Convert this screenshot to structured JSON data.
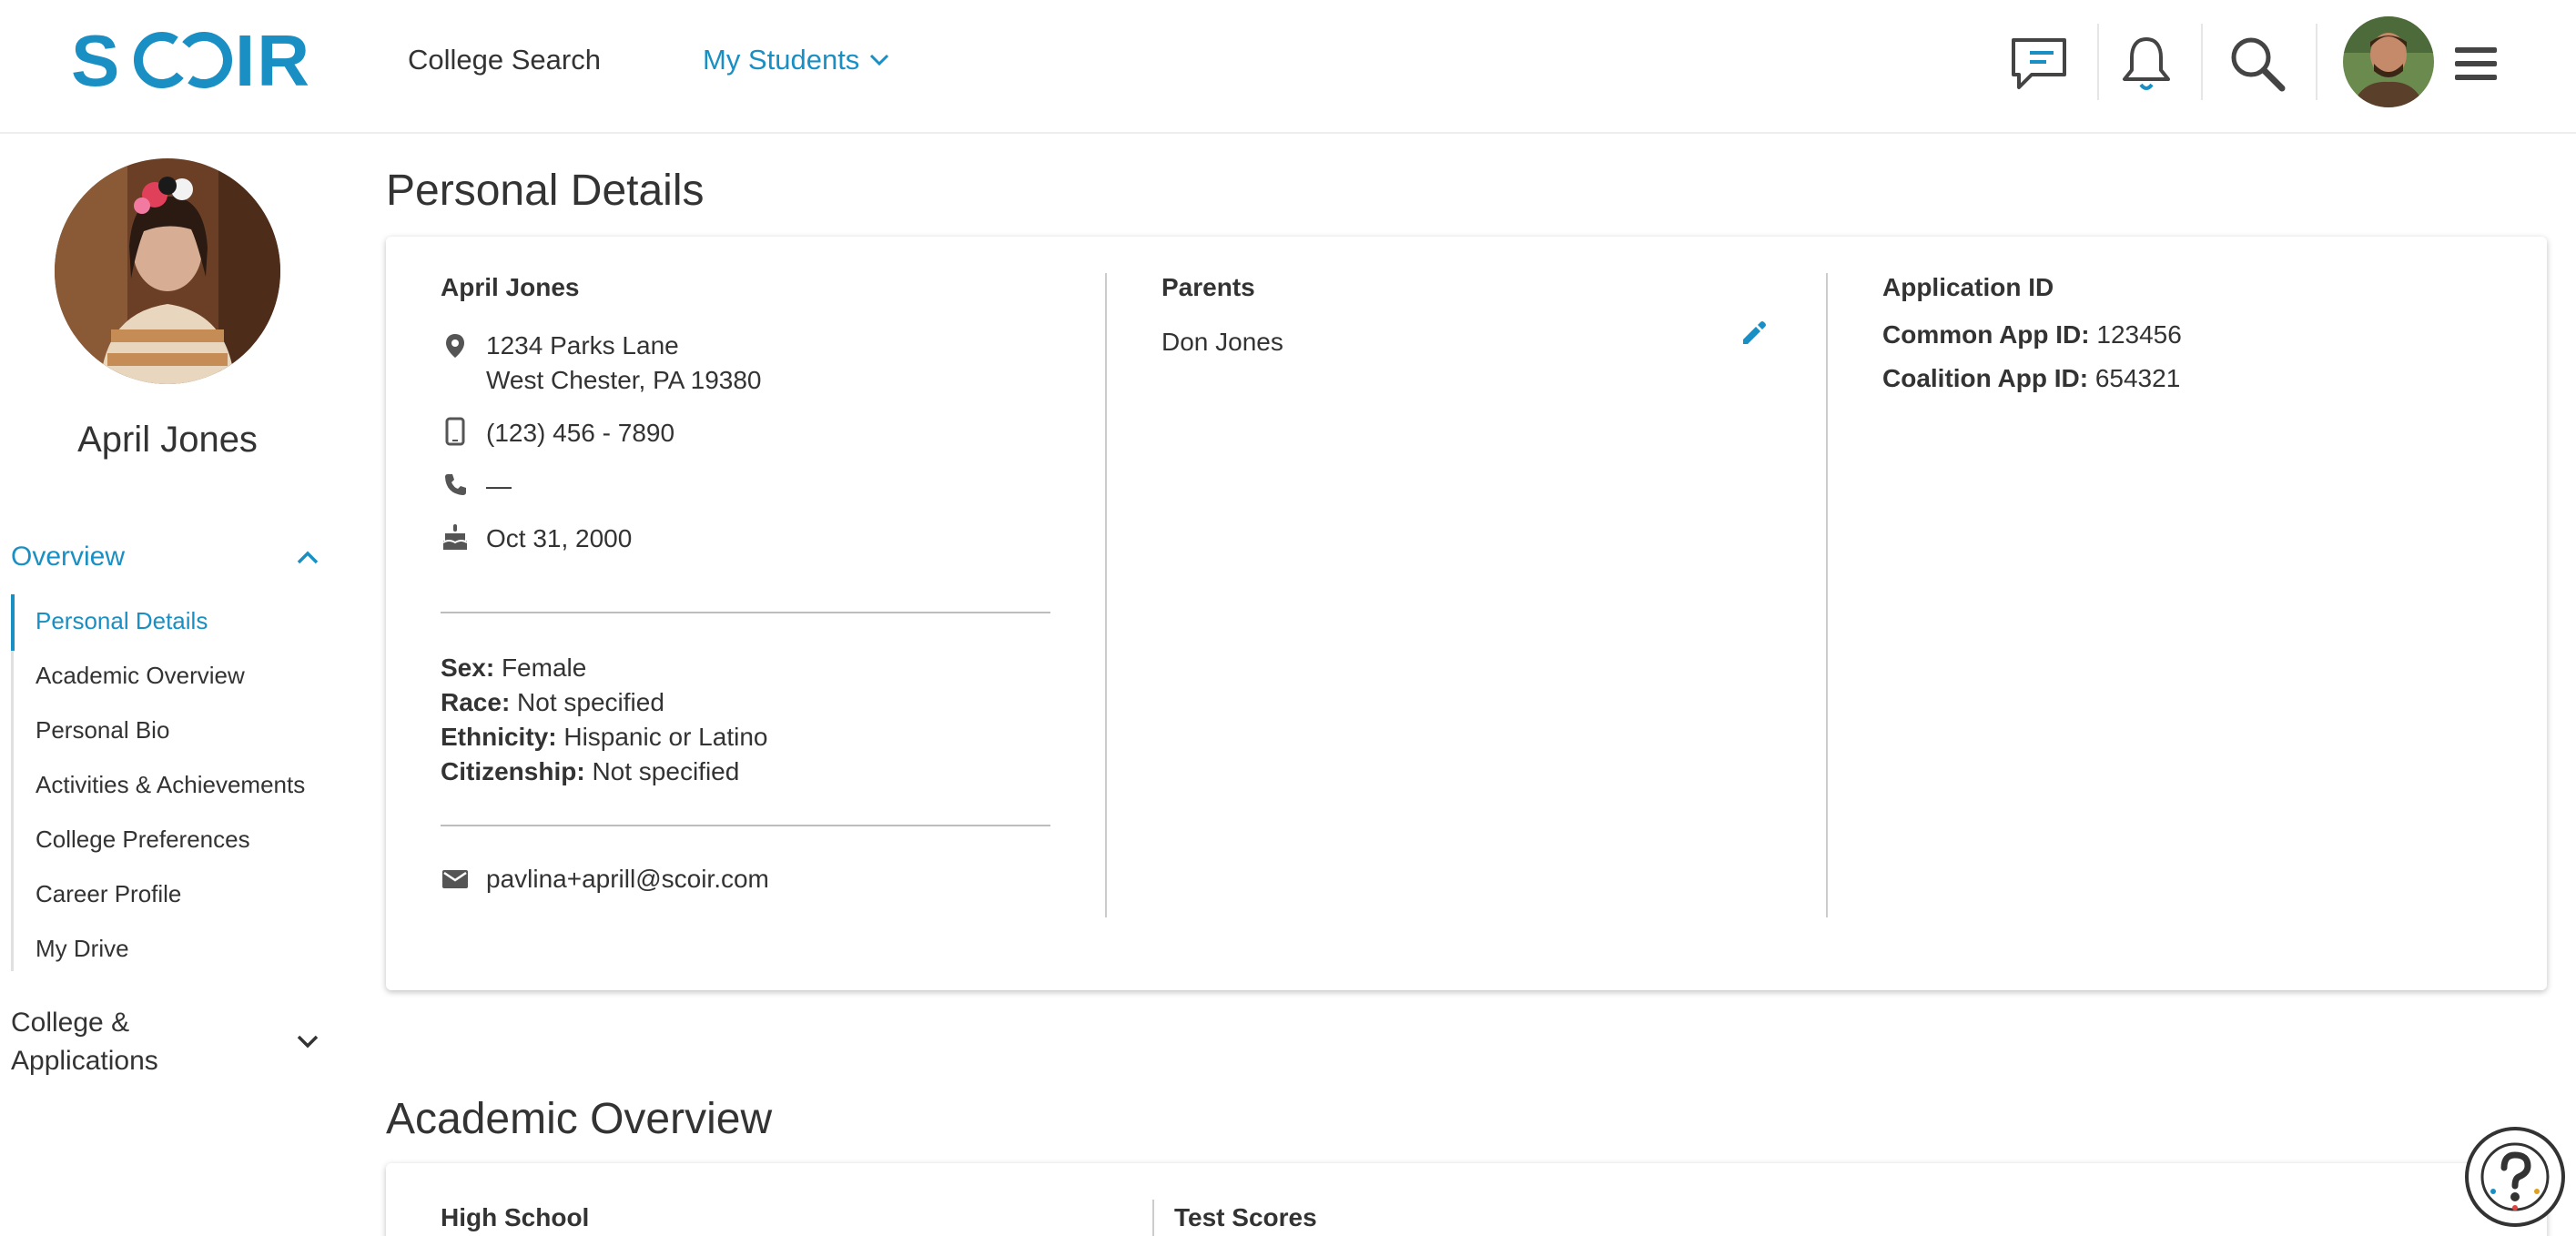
{
  "header": {
    "logo": "SCOIR",
    "nav_college_search": "College Search",
    "nav_my_students": "My Students",
    "icons": [
      "messages-icon",
      "notifications-icon",
      "search-icon",
      "user-avatar",
      "menu-icon"
    ]
  },
  "sidebar": {
    "student_name": "April Jones",
    "overview_label": "Overview",
    "items": [
      {
        "label": "Personal Details",
        "active": true
      },
      {
        "label": "Academic Overview"
      },
      {
        "label": "Personal Bio"
      },
      {
        "label": "Activities & Achievements"
      },
      {
        "label": "College Preferences"
      },
      {
        "label": "Career Profile"
      },
      {
        "label": "My Drive"
      }
    ],
    "college_apps_label_1": "College &",
    "college_apps_label_2": "Applications"
  },
  "personal_details": {
    "title": "Personal Details",
    "name": "April Jones",
    "address_line1": "1234 Parks Lane",
    "address_line2": "West Chester, PA 19380",
    "mobile": "(123) 456 - 7890",
    "phone": "—",
    "birthday": "Oct 31, 2000",
    "sex_label": "Sex:",
    "sex": "Female",
    "race_label": "Race:",
    "race": "Not specified",
    "ethnicity_label": "Ethnicity:",
    "ethnicity": "Hispanic or Latino",
    "citizenship_label": "Citizenship:",
    "citizenship": "Not specified",
    "email": "pavlina+aprill@scoir.com",
    "parents_label": "Parents",
    "parent_name": "Don Jones",
    "application_id_label": "Application ID",
    "common_app_label": "Common App ID:",
    "common_app_id": "123456",
    "coalition_app_label": "Coalition App ID:",
    "coalition_app_id": "654321"
  },
  "academic_overview": {
    "title": "Academic Overview",
    "high_school_label": "High School",
    "test_scores_label": "Test Scores"
  },
  "colors": {
    "accent": "#1a8fc4",
    "text": "#333333",
    "divider": "#cccccc"
  }
}
